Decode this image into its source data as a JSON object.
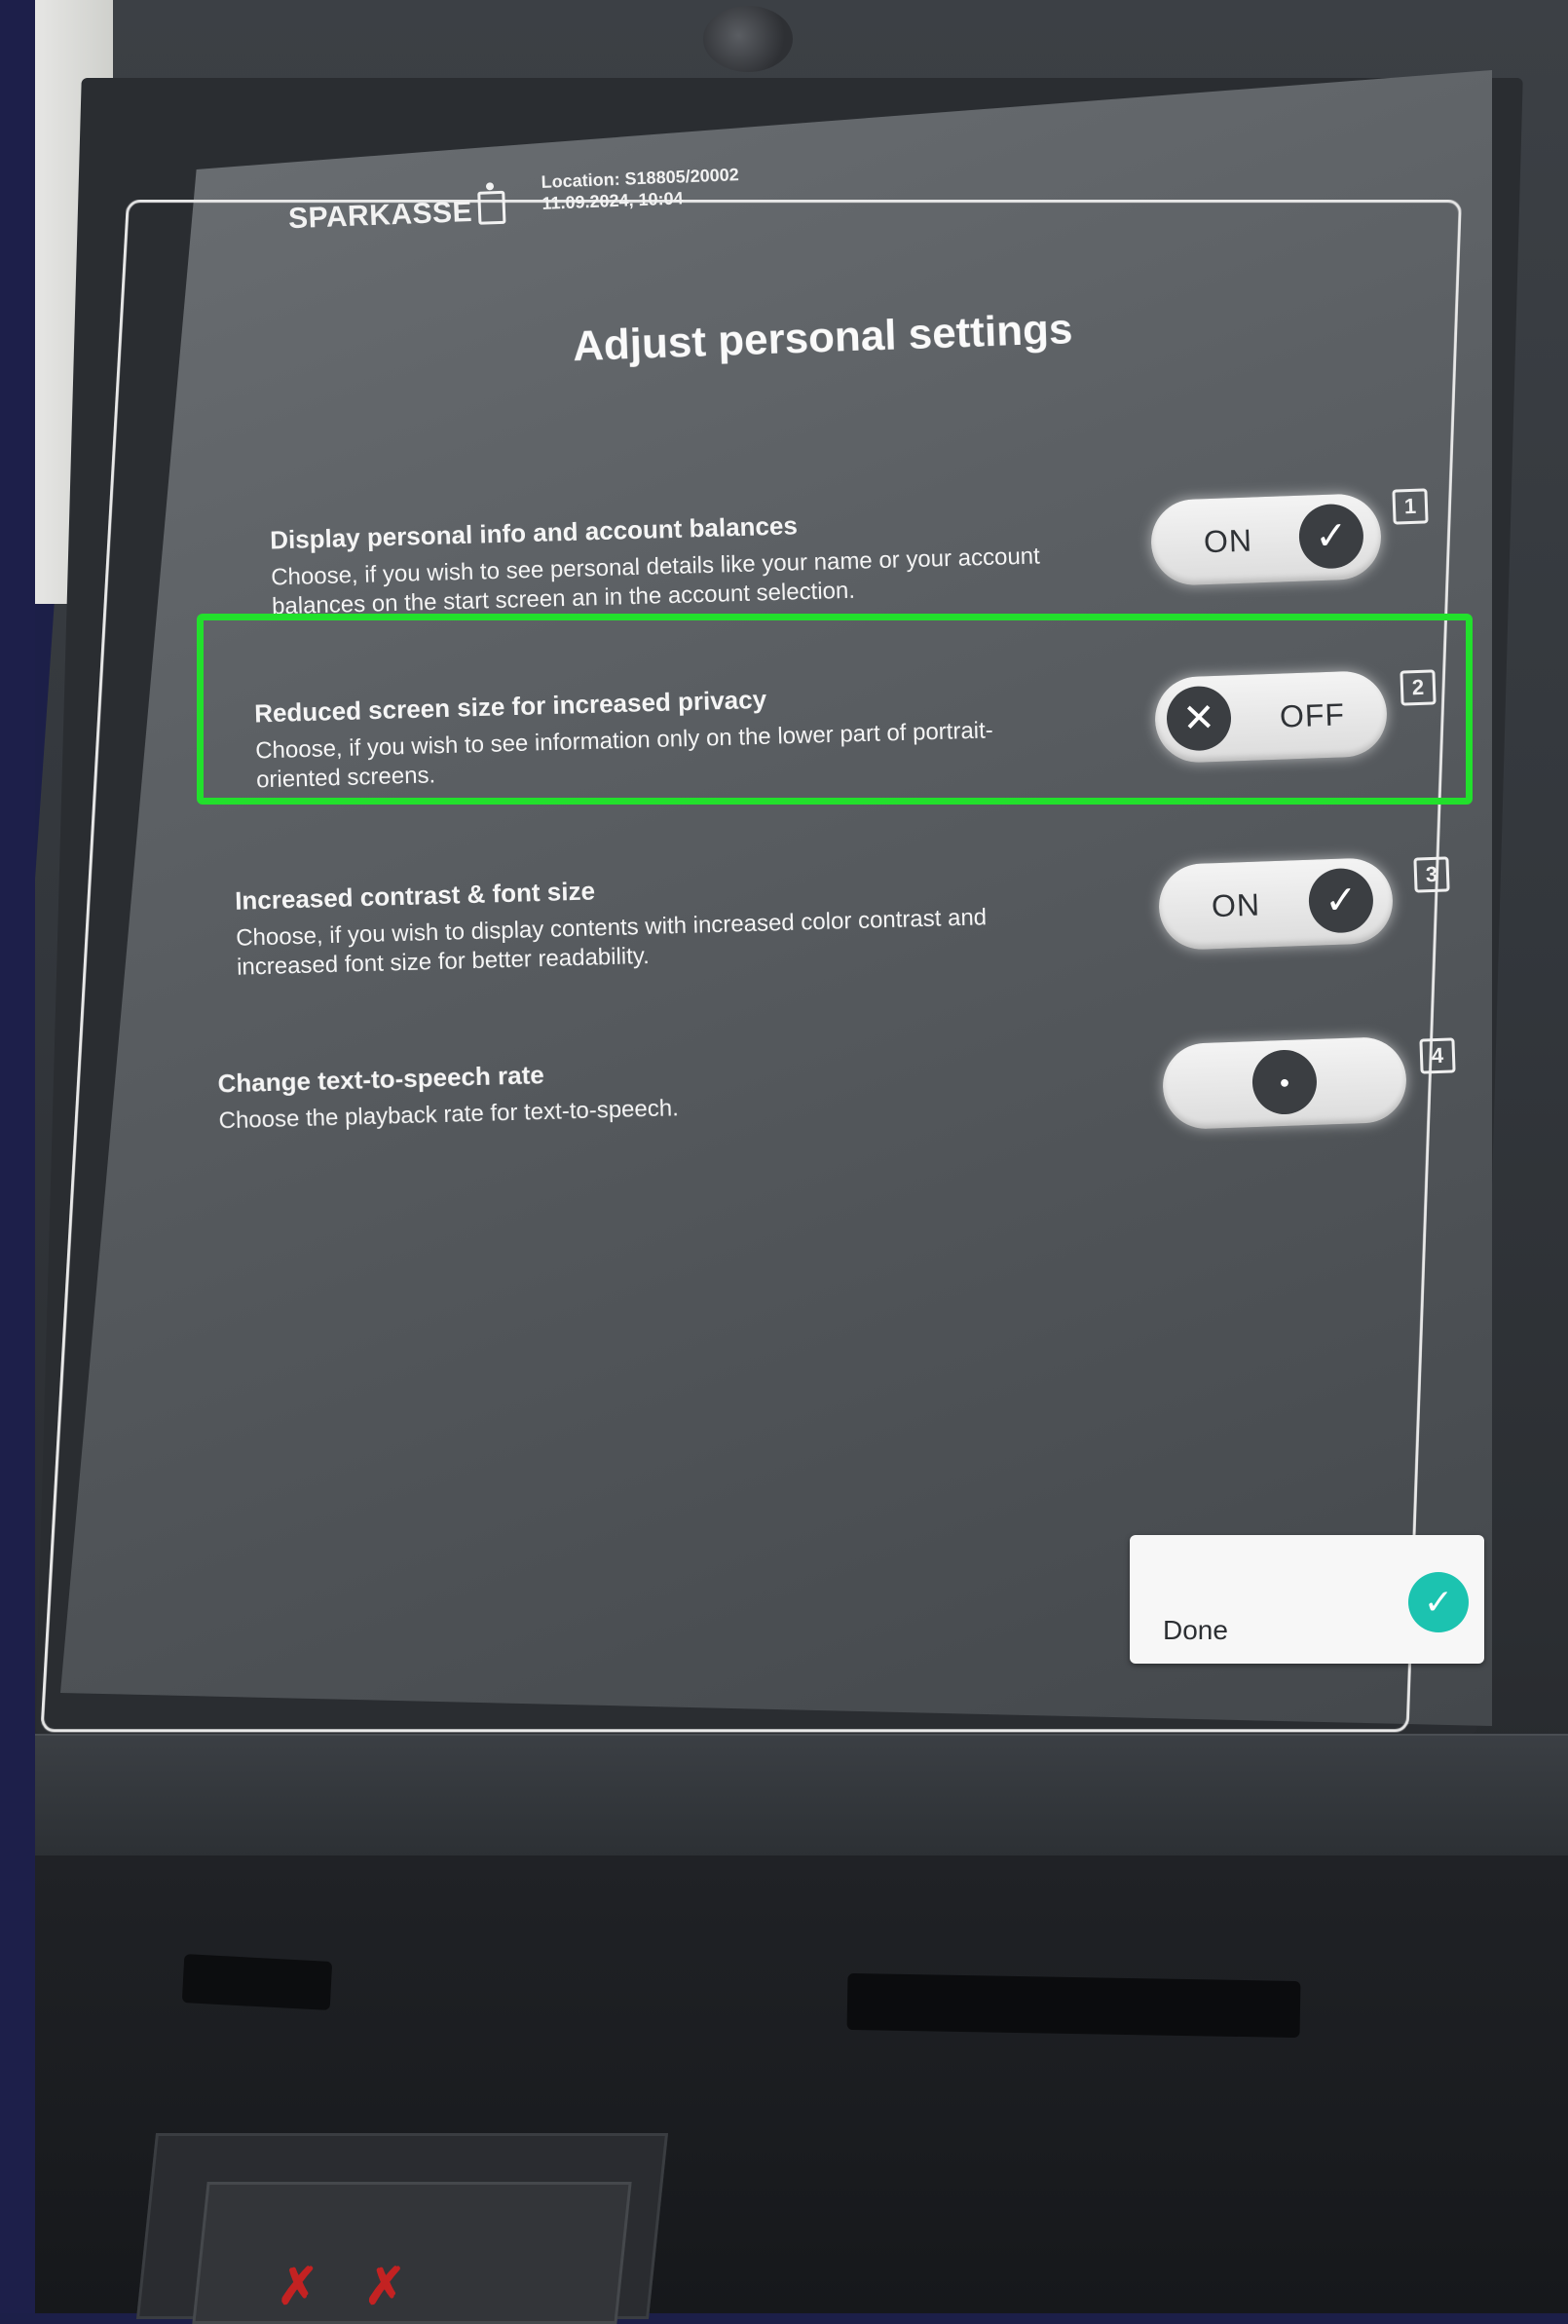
{
  "header": {
    "brand": "SPARKASSE",
    "location": "Location: S18805/20002",
    "datetime": "11.09.2024, 10:04"
  },
  "page": {
    "title": "Adjust personal settings"
  },
  "settings": [
    {
      "title": "Display personal info and account balances",
      "description": "Choose, if you wish to see personal details like your name or your account balances on the start screen an in the account selection.",
      "toggle_label": "ON",
      "state": "on",
      "badge": "1"
    },
    {
      "title": "Reduced screen size for increased privacy",
      "description": "Choose, if you wish to see information only on the lower part of portrait-oriented screens.",
      "toggle_label": "OFF",
      "state": "off",
      "badge": "2"
    },
    {
      "title": "Increased contrast & font size",
      "description": "Choose, if you wish to display contents with increased color contrast and increased font size for better readability.",
      "toggle_label": "ON",
      "state": "on",
      "badge": "3"
    },
    {
      "title": "Change text-to-speech rate",
      "description": "Choose the playback rate for text-to-speech.",
      "toggle_label": "",
      "state": "slider-middle",
      "badge": "4"
    }
  ],
  "done_button": {
    "label": "Done"
  },
  "icons": {
    "check": "check-icon",
    "close": "close-icon",
    "slider_knob": "slider-knob-icon"
  },
  "colors": {
    "highlight": "#22e02c",
    "done_check": "#1cc3b0",
    "toggle_knob": "#3b3e42"
  }
}
